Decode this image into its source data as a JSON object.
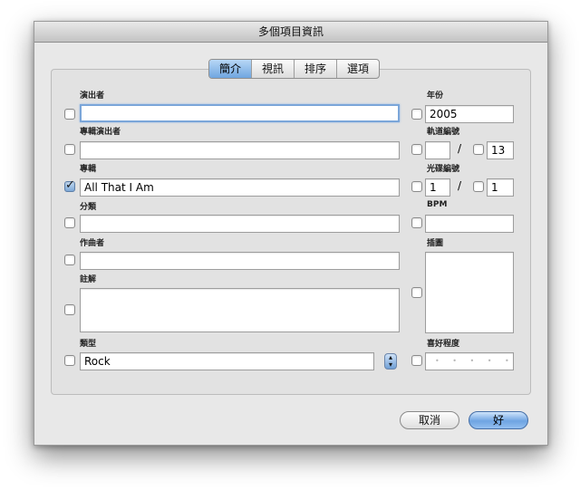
{
  "window": {
    "title": "多個項目資訊"
  },
  "tabs": [
    {
      "label": "簡介",
      "active": true
    },
    {
      "label": "視訊",
      "active": false
    },
    {
      "label": "排序",
      "active": false
    },
    {
      "label": "選項",
      "active": false
    }
  ],
  "fields": {
    "artist": {
      "label": "演出者",
      "value": "",
      "checked": false
    },
    "album_artist": {
      "label": "專輯演出者",
      "value": "",
      "checked": false
    },
    "album": {
      "label": "專輯",
      "value": "All That I Am",
      "checked": true
    },
    "grouping": {
      "label": "分類",
      "value": "",
      "checked": false
    },
    "composer": {
      "label": "作曲者",
      "value": "",
      "checked": false
    },
    "comments": {
      "label": "註解",
      "value": "",
      "checked": false
    },
    "genre": {
      "label": "類型",
      "value": "Rock",
      "checked": false
    },
    "year": {
      "label": "年份",
      "value": "2005",
      "checked": false
    },
    "track_number": {
      "label": "軌道編號",
      "value": "",
      "of": "13",
      "checked": false,
      "of_checked": false
    },
    "disc_number": {
      "label": "光碟編號",
      "value": "1",
      "of": "1",
      "checked": false,
      "of_checked": false
    },
    "bpm": {
      "label": "BPM",
      "value": "",
      "checked": false
    },
    "artwork": {
      "label": "插圖",
      "checked": false
    },
    "rating": {
      "label": "喜好程度",
      "stars": "• • • • •",
      "checked": false
    }
  },
  "separator": "/",
  "buttons": {
    "cancel": "取消",
    "ok": "好"
  },
  "colors": {
    "accent": "#6fa6e0",
    "window_bg": "#e8e8e8"
  }
}
